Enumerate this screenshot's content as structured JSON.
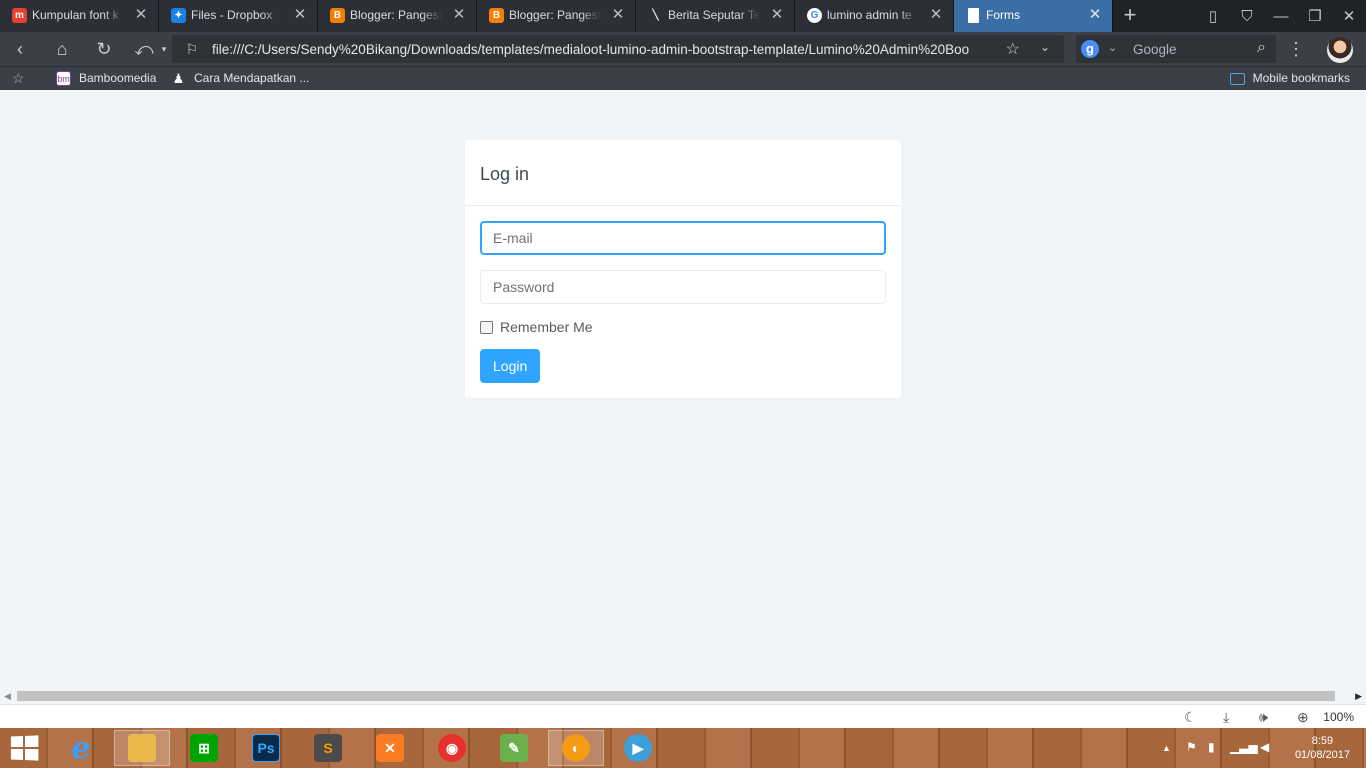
{
  "browser": {
    "tabs": [
      {
        "title": "Kumpulan font k",
        "icon": "mediaLoot-logo-icon",
        "color": "#e8402f",
        "glyph": "m"
      },
      {
        "title": "Files - Dropbox",
        "icon": "dropbox-icon",
        "color": "#1a82e2",
        "glyph": "✦"
      },
      {
        "title": "Blogger: Pangest",
        "icon": "blogger-icon",
        "color": "#f57d00",
        "glyph": "B"
      },
      {
        "title": "Blogger: Pangest",
        "icon": "blogger-icon",
        "color": "#f57d00",
        "glyph": "B"
      },
      {
        "title": "Berita Seputar Te",
        "icon": "feather-icon",
        "color": "#2c3036",
        "glyph": "╲"
      },
      {
        "title": "lumino admin te",
        "icon": "google-icon",
        "color": "#ffffff",
        "glyph": "G"
      },
      {
        "title": "Forms",
        "icon": "document-icon",
        "color": "#ffffff",
        "glyph": "▤"
      }
    ],
    "active_tab_index": 6,
    "new_tab_label": "+",
    "url": "file:///C:/Users/Sendy%20Bikang/Downloads/templates/medialoot-lumino-admin-bootstrap-template/Lumino%20Admin%20Boo",
    "search_engine": "Google",
    "search_badge": "g",
    "bookmarks": [
      {
        "label": "Bamboomedia",
        "icon": "bamboomedia-icon"
      },
      {
        "label": "Cara Mendapatkan ...",
        "icon": "linux-penguin-icon"
      }
    ],
    "mobile_bookmarks": "Mobile bookmarks",
    "zoom": "100%"
  },
  "login": {
    "heading": "Log in",
    "email_placeholder": "E-mail",
    "password_placeholder": "Password",
    "remember_label": "Remember Me",
    "submit_label": "Login"
  },
  "colors": {
    "accent": "#30a5ff",
    "page_bg": "#f1f4f7",
    "active_tab": "#3a6ea5"
  },
  "taskbar": {
    "apps": [
      {
        "name": "internet-explorer-icon",
        "color": "#1e88e5",
        "glyph": "e"
      },
      {
        "name": "file-explorer-icon",
        "color": "#e8b84a",
        "glyph": "▭"
      },
      {
        "name": "windows-store-icon",
        "color": "#00a300",
        "glyph": "⊞"
      },
      {
        "name": "photoshop-icon",
        "color": "#0b2a4a",
        "glyph": "Ps"
      },
      {
        "name": "sublime-text-icon",
        "color": "#4b4b4b",
        "glyph": "S"
      },
      {
        "name": "xampp-icon",
        "color": "#fb7a24",
        "glyph": "✕"
      },
      {
        "name": "foxit-reader-icon",
        "color": "#e6302b",
        "glyph": "◉"
      },
      {
        "name": "coreldraw-icon",
        "color": "#6ab04c",
        "glyph": "✎"
      },
      {
        "name": "uc-browser-icon",
        "color": "#f59b16",
        "glyph": "◐"
      },
      {
        "name": "media-player-icon",
        "color": "#3da0d8",
        "glyph": "▶"
      }
    ],
    "time": "8:59",
    "date": "01/08/2017"
  }
}
